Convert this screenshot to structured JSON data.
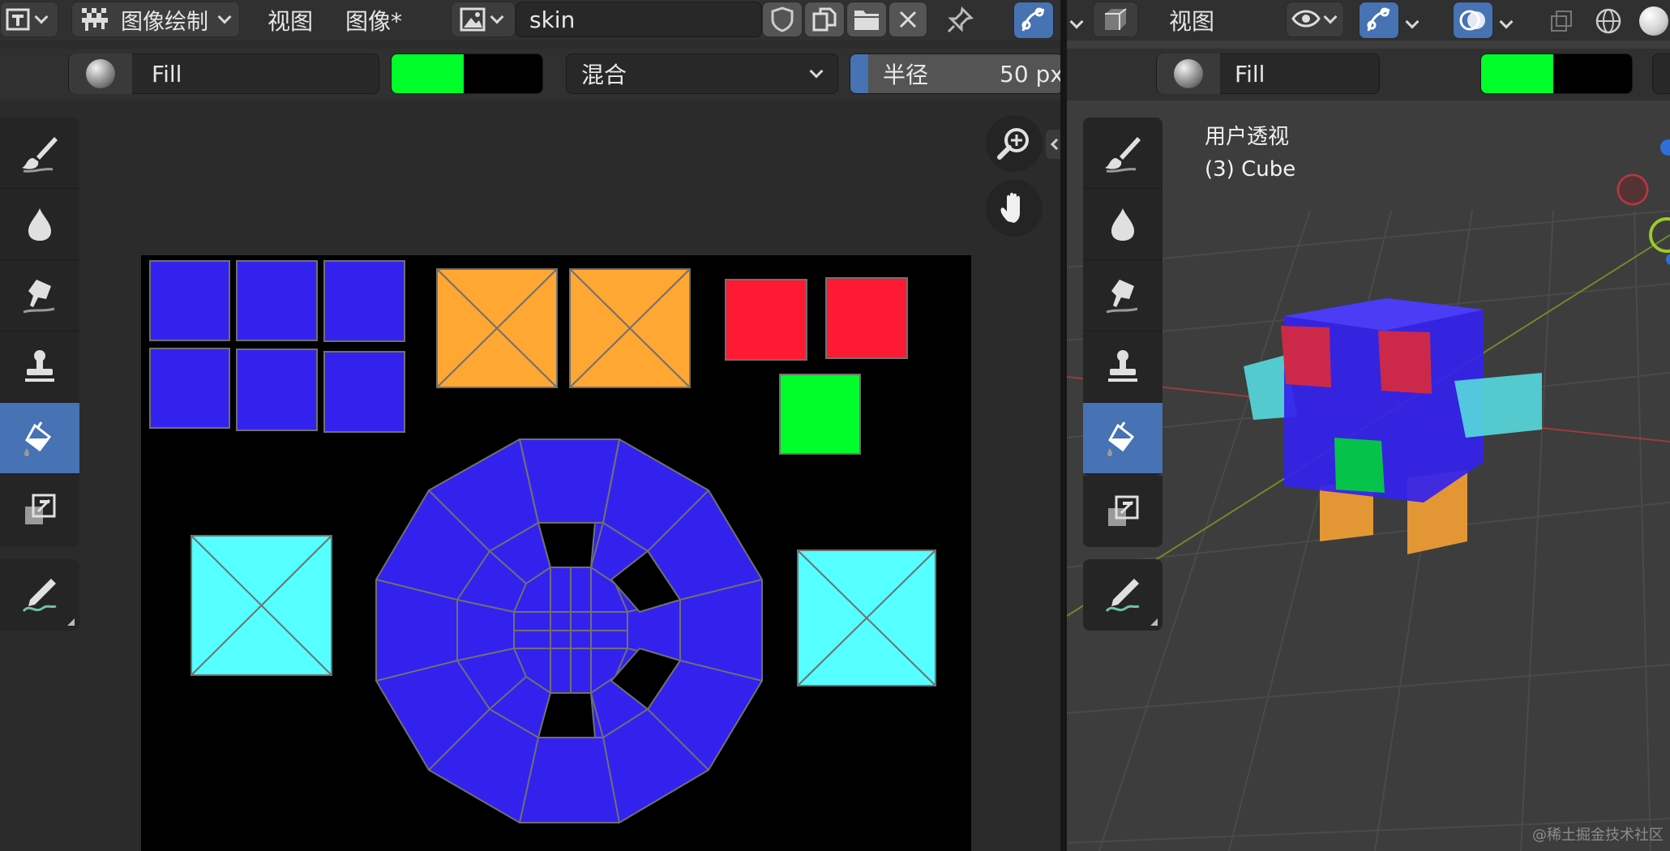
{
  "left_header": {
    "mode_label": "图像绘制",
    "view_menu": "视图",
    "image_menu": "图像*",
    "image_name": "skin"
  },
  "left_toolbar": {
    "brush_name": "Fill",
    "blend_mode": "混合",
    "radius_label": "半径",
    "radius_value": "50 px",
    "primary_color": "#00ff2a",
    "secondary_color": "#000000"
  },
  "right_header": {
    "view_menu": "视图"
  },
  "right_toolbar": {
    "brush_name": "Fill",
    "primary_color": "#00ff2a",
    "secondary_color": "#000000"
  },
  "viewport": {
    "perspective_label": "用户透视",
    "object_label": "(3) Cube"
  },
  "watermark": "@稀土掘金技术社区",
  "tools": [
    "draw-brush",
    "soften",
    "smear",
    "clone",
    "fill",
    "mask",
    "annotate"
  ],
  "colors": {
    "accent": "#4772b3",
    "uv_blue": "#3322ee",
    "uv_orange": "#ffa633",
    "uv_red": "#ff1a33",
    "uv_green": "#00ff2a",
    "uv_cyan": "#55ffff"
  }
}
